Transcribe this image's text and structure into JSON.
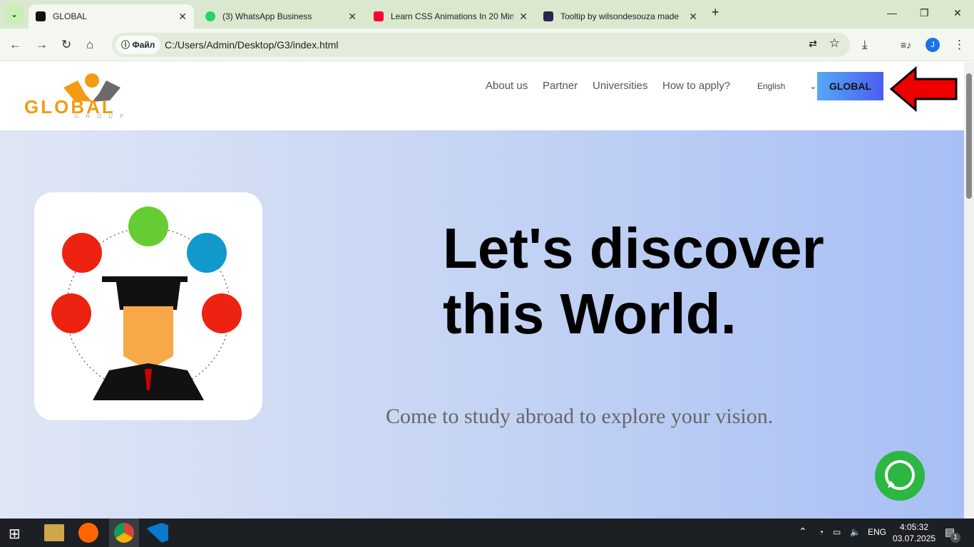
{
  "browser": {
    "tabs": [
      {
        "label": "GLOBAL",
        "active": true,
        "color": "#111"
      },
      {
        "label": "(3) WhatsApp Business",
        "active": false,
        "color": "#25d366"
      },
      {
        "label": "Learn CSS Animations In 20 Min",
        "active": false,
        "color": "#ff0033"
      },
      {
        "label": "Tooltip by wilsondesouza made",
        "active": false,
        "color": "#2b2350"
      }
    ],
    "chip": "Файл",
    "url": "C:/Users/Admin/Desktop/G3/index.html",
    "profile": "J"
  },
  "site": {
    "logo_text": "GLOBAL",
    "logo_sub": "GROUP",
    "nav": [
      "About us",
      "Partner",
      "Universities",
      "How to apply?"
    ],
    "language": "English",
    "cta": "GLOBAL",
    "headline_1": "Let's discover",
    "headline_2": "this World.",
    "subtitle": "Come to study abroad to explore your vision."
  },
  "taskbar": {
    "lang": "ENG",
    "time": "4:05:32",
    "date": "03.07.2025",
    "notifications": "1"
  }
}
